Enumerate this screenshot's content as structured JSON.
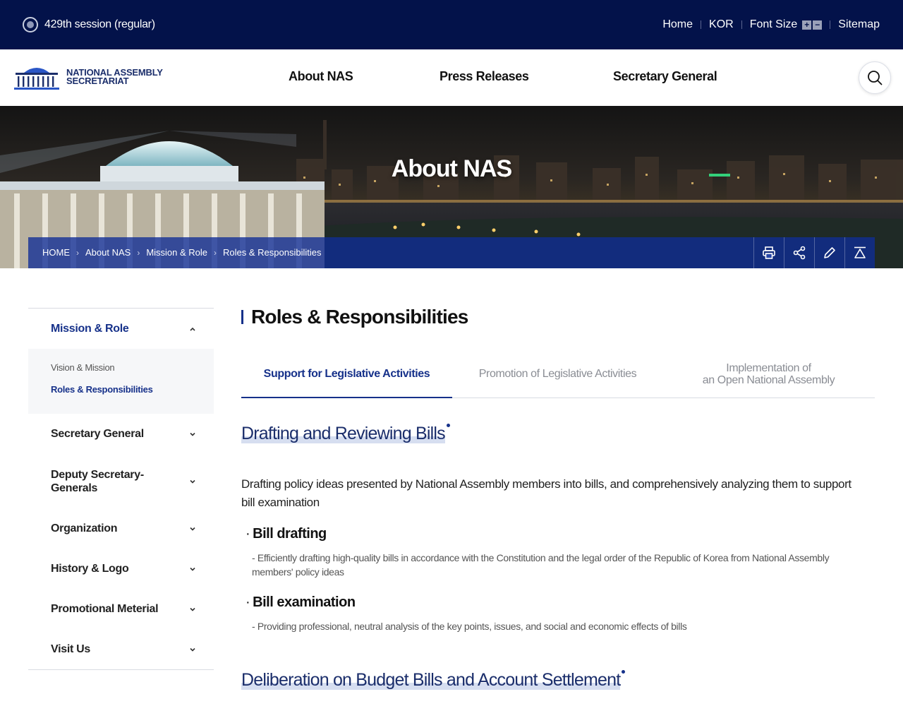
{
  "utility": {
    "session": "429th session (regular)",
    "links": [
      "Home",
      "KOR",
      "Font Size",
      "Sitemap"
    ],
    "font_plus": "+",
    "font_minus": "−"
  },
  "logo": {
    "line1": "NATIONAL ASSEMBLY",
    "line2": "SECRETARIAT"
  },
  "gnb": [
    "About NAS",
    "Press Releases",
    "Secretary General"
  ],
  "hero": {
    "title": "About NAS"
  },
  "breadcrumb": [
    "HOME",
    "About NAS",
    "Mission & Role",
    "Roles & Responsibilities"
  ],
  "tools": [
    "print-icon",
    "share-icon",
    "edit-icon",
    "top-icon"
  ],
  "lnb": {
    "items": [
      "Mission & Role",
      "Secretary General",
      "Deputy Secretary-Generals",
      "Organization",
      "History & Logo",
      "Promotional Meterial",
      "Visit Us"
    ],
    "sub": [
      "Vision & Mission",
      "Roles & Responsibilities"
    ]
  },
  "content": {
    "title": "Roles & Responsibilities",
    "tabs": [
      "Support for Legislative Activities",
      "Promotion of Legislative Activities",
      "Implementation of\nan Open National Assembly"
    ],
    "sections": [
      {
        "title": "Drafting and Reviewing Bills",
        "intro": "Drafting policy ideas presented by National Assembly members into bills, and comprehensively analyzing them to support bill examination",
        "items": [
          {
            "title": "Bill drafting",
            "desc": "- Efficiently drafting high-quality bills in accordance with the Constitution and the legal order of the Republic of Korea from National Assembly members' policy ideas"
          },
          {
            "title": "Bill examination",
            "desc": "- Providing professional, neutral analysis of the key points, issues, and social and economic effects of bills"
          }
        ]
      },
      {
        "title": "Deliberation on Budget Bills and Account Settlement"
      }
    ]
  },
  "colors": {
    "navy": "#03124a",
    "accent": "#16318a",
    "crumb_bar": "#0f2d96"
  }
}
